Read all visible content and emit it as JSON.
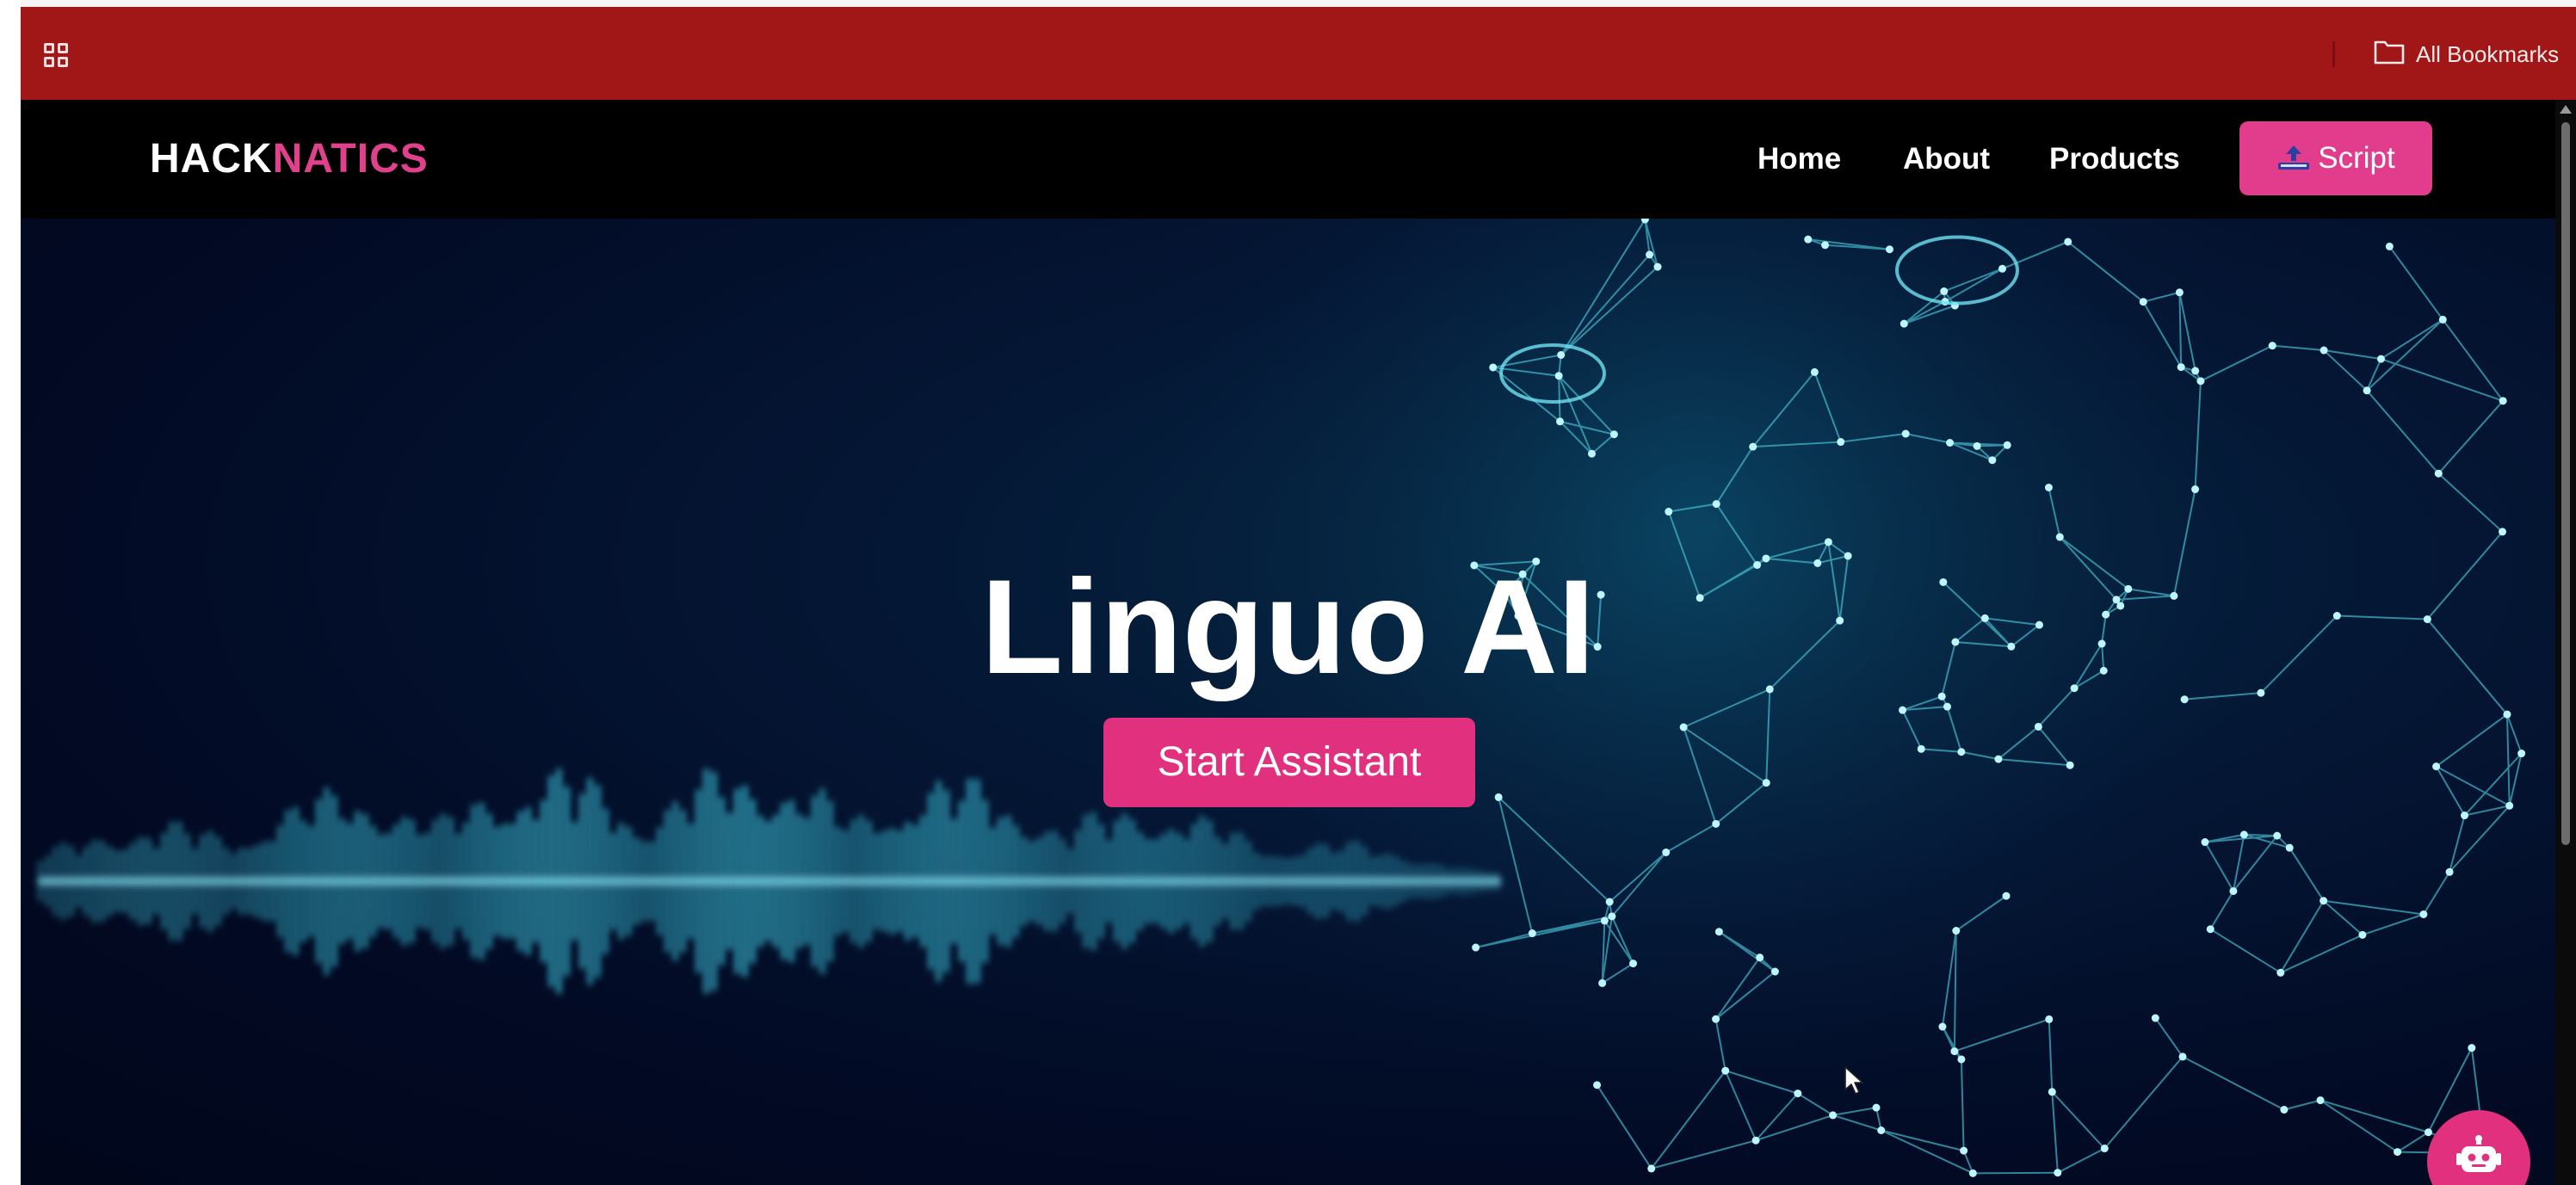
{
  "browser": {
    "apps_icon": "apps-grid-icon",
    "bookmarks_label": "All Bookmarks",
    "bookmarks_icon": "folder-icon",
    "bar_color": "#a11616"
  },
  "nav": {
    "logo_part1": "HACK",
    "logo_part2": "NATICS",
    "links": [
      "Home",
      "About",
      "Products"
    ],
    "script_label": "Script",
    "script_icon": "upload-tray-icon",
    "accent": "#e23c8c"
  },
  "hero": {
    "title": "Linguo AI",
    "start_button": "Start Assistant",
    "background_image": "sound-wave-and-polygon-face",
    "assistant_icon": "robot-icon"
  }
}
